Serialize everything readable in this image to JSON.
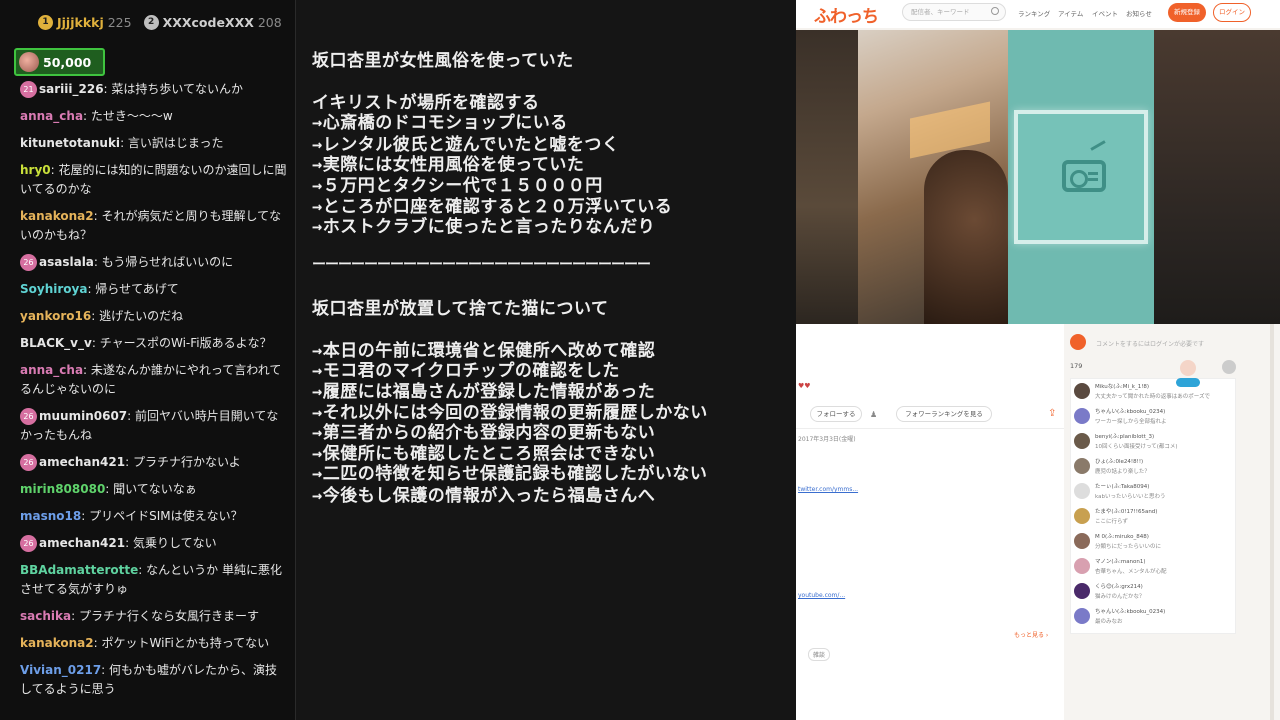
{
  "chat": {
    "leaders": [
      {
        "rank": "1",
        "name": "Jjjjkkkj",
        "score": "225"
      },
      {
        "rank": "2",
        "name": "XXXcodeXXX",
        "score": "208"
      }
    ],
    "gift_amount": "50,000",
    "messages": [
      {
        "badge": "21",
        "user": "sariii_226",
        "text": ": 菜は持ち歩いてないんか",
        "color": "#e6e6e6"
      },
      {
        "badge": "",
        "user": "anna_cha",
        "text": ": たせき〜〜〜w",
        "color": "#d97bb3"
      },
      {
        "badge": "",
        "user": "kitunetotanuki",
        "text": ": 言い訳はじまった",
        "color": "#e6e6e6"
      },
      {
        "badge": "",
        "user": "hry0",
        "text": ": 花屋的には知的に問題ないのか遠回しに聞いてるのかな",
        "color": "#c9e03a"
      },
      {
        "badge": "",
        "user": "kanakona2",
        "text": ": それが病気だと周りも理解してないのかもね？",
        "color": "#e5b35a"
      },
      {
        "badge": "26",
        "user": "asaslala",
        "text": ": もう帰らせればいいのに",
        "color": "#e6e6e6"
      },
      {
        "badge": "",
        "user": "Soyhiroya",
        "text": ": 帰らせてあげて",
        "color": "#5fd3d3"
      },
      {
        "badge": "",
        "user": "yankoro16",
        "text": ": 逃げたいのだね",
        "color": "#e5b35a"
      },
      {
        "badge": "",
        "user": "BLACK_v_v",
        "text": ": チャースポのWi-Fi版あるよな？",
        "color": "#e6e6e6"
      },
      {
        "badge": "",
        "user": "anna_cha",
        "text": ": 未遂なんか誰かにやれって言われてるんじゃないのに",
        "color": "#d97bb3"
      },
      {
        "badge": "26",
        "user": "muumin0607",
        "text": ": 前回ヤバい時片目開いてなかったもんね",
        "color": "#e6e6e6"
      },
      {
        "badge": "26",
        "user": "amechan421",
        "text": ": プラチナ行かないよ",
        "color": "#e6e6e6"
      },
      {
        "badge": "",
        "user": "mirin808080",
        "text": ": 聞いてないなぁ",
        "color": "#5fd36b"
      },
      {
        "badge": "",
        "user": "masno18",
        "text": ": プリペイドSIMは使えない？",
        "color": "#6d9ee8"
      },
      {
        "badge": "26",
        "user": "amechan421",
        "text": ": 気乗りしてない",
        "color": "#e6e6e6"
      },
      {
        "badge": "",
        "user": "BBAdamatterotte",
        "text": ": なんというか 単純に悪化させてる気がすりゅ",
        "color": "#5fd3a0"
      },
      {
        "badge": "",
        "user": "sachika",
        "text": ": プラチナ行くなら女風行きまーす",
        "color": "#d97bb3"
      },
      {
        "badge": "",
        "user": "kanakona2",
        "text": ": ポケットWiFiとかも持ってない",
        "color": "#e5b35a"
      },
      {
        "badge": "",
        "user": "Vivian_0217",
        "text": ": 何もかも嘘がバレたから、演技してるように思う",
        "color": "#6d9ee8"
      }
    ]
  },
  "memo": {
    "lines": [
      "坂口杏里が女性風俗を使っていた",
      "",
      "イキリストが場所を確認する",
      "→心斎橋のドコモショップにいる",
      "→レンタル彼氏と遊んでいたと嘘をつく",
      "→実際には女性用風俗を使っていた",
      "→５万円とタクシー代で１５０００円",
      "→ところが口座を確認すると２０万浮いている",
      "→ホストクラブに使ったと言ったりなんだり",
      "",
      "ーーーーーーーーーーーーーーーーーーーーーーーーーー",
      "",
      "坂口杏里が放置して捨てた猫について",
      "",
      "→本日の午前に環境省と保健所へ改めて確認",
      "→モコ君のマイクロチップの確認をした",
      "→履歴には福島さんが登録した情報があった",
      "→それ以外には今回の登録情報の更新履歴しかない",
      "→第三者からの紹介も登録内容の更新もない",
      "→保健所にも確認したところ照会はできない",
      "→二匹の特徴を知らせ保護記録も確認したがいない",
      "→今後もし保護の情報が入ったら福島さんへ"
    ]
  },
  "browser": {
    "logo": "ふわっち",
    "search_placeholder": "配信者、キーワード",
    "nav": [
      "ランキング",
      "アイテム",
      "イベント",
      "お知らせ"
    ],
    "register": "新規登録",
    "login": "ログイン",
    "page": {
      "follow": "フォローする",
      "ranking": "フォワーランキングを見る",
      "date": "2017年3月3日(金曜)",
      "link1": "twitter.com/ymms...",
      "link2": "youtube.com/...",
      "more": "もっと見る ›",
      "tag": "雑談"
    },
    "comments": {
      "placeholder": "コメントをするにはログインが必要です",
      "count": "179",
      "items": [
        {
          "name": "Mikuな(ふ:Mi_k_1!8)",
          "text": "大丈夫かって聞かれた時の返事はあのポーズで",
          "color": "#5a4a40"
        },
        {
          "name": "ちゃんい(ふ:kbooku_0234)",
          "text": "ワーカー探しから全部指れよ",
          "color": "#7a7ac8"
        },
        {
          "name": "benyi(ふ:planiblott_3)",
          "text": "10回くらい面接受けって(都コメ)",
          "color": "#6a5a4a"
        },
        {
          "name": "ひょ(ふ:0le24!8!!)",
          "text": "鹿児の話より楽した？",
          "color": "#8a7a6a"
        },
        {
          "name": "たーぃ(ふ:Taka8094)",
          "text": "kabいったいらいいと思わう",
          "color": "#dddddd"
        },
        {
          "name": "たまや(ふ:0!17!!65and)",
          "text": "ここに行らず",
          "color": "#c8a050"
        },
        {
          "name": "M 0(ふ:miruko_848)",
          "text": "分類ちにだったらいいのに",
          "color": "#8a6a5a"
        },
        {
          "name": "マノン(ふ:manon1)",
          "text": "杏華ちゃん、メンタルが心配",
          "color": "#d8a0b0"
        },
        {
          "name": "くら😊(ふ:grx214)",
          "text": "猫みけのんだかな？",
          "color": "#4a2a6a"
        },
        {
          "name": "ちゃんい(ふ:kbooku_0234)",
          "text": "最のみなお",
          "color": "#7a7ac8"
        }
      ]
    }
  }
}
